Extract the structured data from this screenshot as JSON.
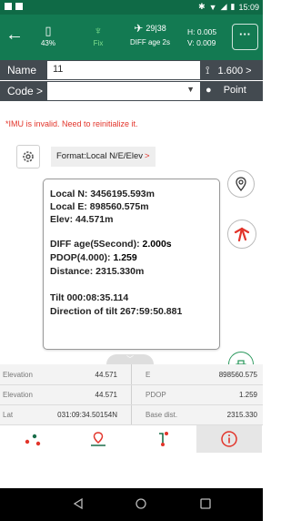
{
  "status_bar": {
    "time": "15:09"
  },
  "gnss": {
    "battery": "43%",
    "fix": "Fix",
    "satellites": "29|38",
    "diff_age": "DIFF age 2s",
    "h_precision": "H: 0.005",
    "v_precision": "V: 0.009",
    "more_label": "···"
  },
  "name_row": {
    "label": "Name",
    "value": "11",
    "height_value": "1.600 >"
  },
  "code_row": {
    "label": "Code >",
    "value": "",
    "dropdown": "▼",
    "type_label": "Point"
  },
  "warning": "*IMU is invalid. Need to reinitialize it.",
  "format": {
    "text": "Format:Local N/E/Elev",
    "chevron": ">"
  },
  "card": {
    "local_n": "Local N:  3456195.593m",
    "local_e": "Local E:  898560.575m",
    "elev": "Elev:  44.571m",
    "diff_age_label": "DIFF age(5Second): ",
    "diff_age_value": "2.000s",
    "pdop_label": "PDOP(4.000): ",
    "pdop_value": "1.259",
    "distance": "Distance:  2315.330m",
    "tilt": "Tilt  000:08:35.114",
    "direction": "Direction of tilt  267:59:50.881"
  },
  "grid": [
    {
      "l_label": "Elevation",
      "l_value": "44.571",
      "r_label": "E",
      "r_value": "898560.575"
    },
    {
      "l_label": "Elevation",
      "l_value": "44.571",
      "r_label": "PDOP",
      "r_value": "1.259"
    },
    {
      "l_label": "Lat",
      "l_value": "031:09:34.50154N",
      "r_label": "Base dist.",
      "r_value": "2315.330"
    }
  ],
  "colors": {
    "primary": "#137a52",
    "dark_row": "#434a50",
    "accent": "#e2342a",
    "fix": "#7fe08e"
  }
}
